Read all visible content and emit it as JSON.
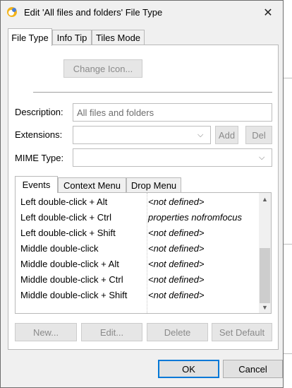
{
  "window": {
    "title": "Edit 'All files and folders' File Type",
    "close_icon": "close-icon"
  },
  "tabs": [
    {
      "label": "File Type",
      "active": true
    },
    {
      "label": "Info Tip",
      "active": false
    },
    {
      "label": "Tiles Mode",
      "active": false
    }
  ],
  "file_type": {
    "change_icon_label": "Change Icon...",
    "description_label": "Description:",
    "description_value": "All files and folders",
    "extensions_label": "Extensions:",
    "extensions_value": "",
    "add_label": "Add",
    "del_label": "Del",
    "mime_label": "MIME Type:",
    "mime_value": ""
  },
  "subtabs": [
    {
      "label": "Events",
      "active": true
    },
    {
      "label": "Context Menu",
      "active": false
    },
    {
      "label": "Drop Menu",
      "active": false
    }
  ],
  "events": [
    {
      "event": "Left double-click + Alt",
      "action": "<not defined>"
    },
    {
      "event": "Left double-click + Ctrl",
      "action": "properties nofromfocus"
    },
    {
      "event": "Left double-click + Shift",
      "action": "<not defined>"
    },
    {
      "event": "Middle double-click",
      "action": "<not defined>"
    },
    {
      "event": "Middle double-click + Alt",
      "action": "<not defined>"
    },
    {
      "event": "Middle double-click + Ctrl",
      "action": "<not defined>"
    },
    {
      "event": "Middle double-click + Shift",
      "action": "<not defined>"
    }
  ],
  "list_buttons": {
    "new_label": "New...",
    "edit_label": "Edit...",
    "delete_label": "Delete",
    "set_default_label": "Set Default"
  },
  "dialog_buttons": {
    "ok_label": "OK",
    "cancel_label": "Cancel"
  },
  "colors": {
    "accent": "#0078d7",
    "dialog_bg": "#f0f0f0",
    "disabled_text": "#8a8a8a"
  }
}
